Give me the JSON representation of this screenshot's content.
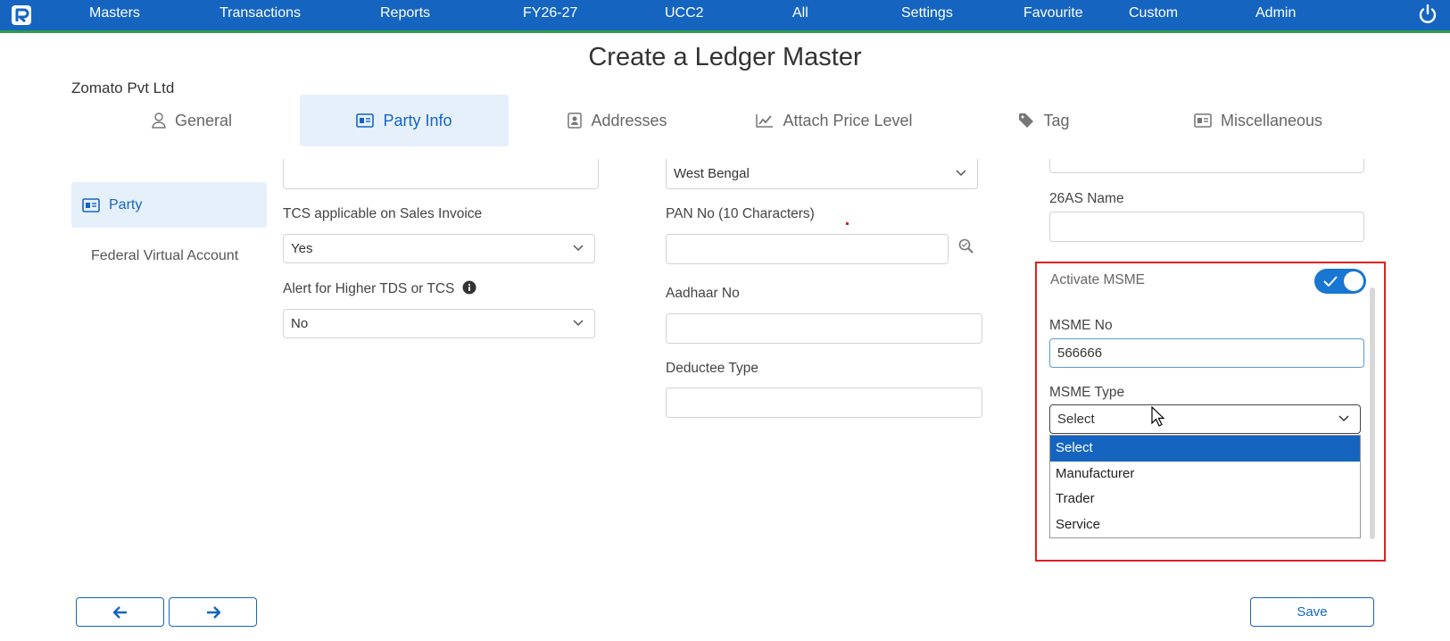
{
  "nav": {
    "items": [
      "Masters",
      "Transactions",
      "Reports",
      "FY26-27",
      "UCC2",
      "All",
      "Settings",
      "Favourite",
      "Custom",
      "Admin"
    ]
  },
  "page": {
    "title": "Create a Ledger Master",
    "company": "Zomato Pvt Ltd"
  },
  "tabs": [
    {
      "label": "General",
      "icon": "user-icon"
    },
    {
      "label": "Party Info",
      "icon": "id-card-icon",
      "active": true
    },
    {
      "label": "Addresses",
      "icon": "address-book-icon"
    },
    {
      "label": "Attach Price Level",
      "icon": "line-chart-icon"
    },
    {
      "label": "Tag",
      "icon": "tag-icon"
    },
    {
      "label": "Miscellaneous",
      "icon": "id-card-icon"
    }
  ],
  "sidebar": {
    "items": [
      {
        "label": "Party",
        "active": true
      },
      {
        "label": "Federal Virtual Account"
      }
    ]
  },
  "form": {
    "col1": {
      "tcs_label": "TCS applicable on Sales Invoice",
      "tcs_value": "Yes",
      "alert_label": "Alert for Higher TDS or TCS",
      "alert_value": "No"
    },
    "col2": {
      "state_value": "West Bengal",
      "pan_label": "PAN No (10 Characters)",
      "pan_value": "",
      "aadhaar_label": "Aadhaar No",
      "aadhaar_value": "",
      "deductee_label": "Deductee Type",
      "deductee_value": ""
    },
    "col3": {
      "name26as_label": "26AS Name",
      "name26as_value": "",
      "activate_msme_label": "Activate MSME",
      "activate_msme_on": true,
      "msme_no_label": "MSME No",
      "msme_no_value": "566666",
      "msme_type_label": "MSME Type",
      "msme_type_value": "Select",
      "msme_type_options": [
        "Select",
        "Manufacturer",
        "Trader",
        "Service"
      ],
      "msme_type_highlighted": "Select"
    }
  },
  "footer": {
    "save_label": "Save"
  },
  "colors": {
    "brand": "#1565c0",
    "accent_line": "#2e9d4a",
    "highlight": "#e02020",
    "active_tab_bg": "#e6f0fb"
  }
}
